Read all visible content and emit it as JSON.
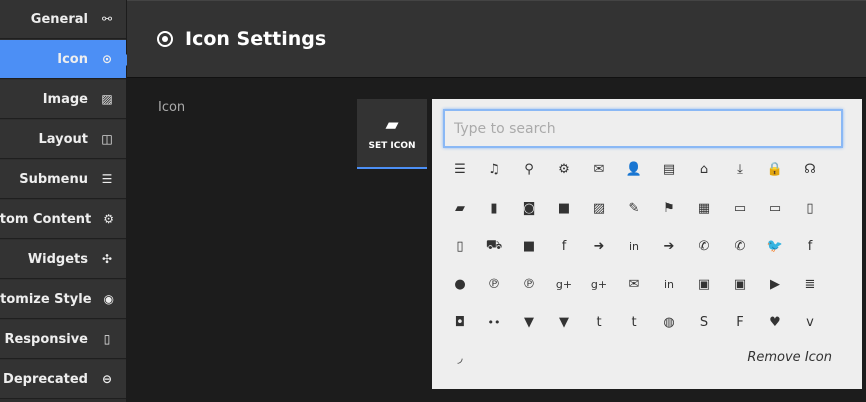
{
  "sidebar": {
    "items": [
      {
        "label": "General",
        "icon": "link-icon",
        "glyph": "⚯"
      },
      {
        "label": "Icon",
        "icon": "dot-circle-icon",
        "glyph": "⊙",
        "active": true
      },
      {
        "label": "Image",
        "icon": "image-icon",
        "glyph": "▨"
      },
      {
        "label": "Layout",
        "icon": "columns-icon",
        "glyph": "◫"
      },
      {
        "label": "Submenu",
        "icon": "list-alt-icon",
        "glyph": "☰"
      },
      {
        "label": "Custom Content",
        "icon": "cogs-icon",
        "glyph": "⚙"
      },
      {
        "label": "Widgets",
        "icon": "puzzle-icon",
        "glyph": "✣"
      },
      {
        "label": "Customize Style",
        "icon": "eye-icon",
        "glyph": "◉"
      },
      {
        "label": "Responsive",
        "icon": "tablet-icon",
        "glyph": "▯"
      },
      {
        "label": "Deprecated",
        "icon": "minus-circle-icon",
        "glyph": "⊖"
      }
    ]
  },
  "header": {
    "title": "Icon Settings"
  },
  "field": {
    "label": "Icon"
  },
  "set_icon": {
    "label": "SET ICON"
  },
  "picker": {
    "search_placeholder": "Type to search",
    "remove_label": "Remove Icon",
    "icons": [
      [
        "bars",
        "☰"
      ],
      [
        "music",
        "♫"
      ],
      [
        "search",
        "⚲"
      ],
      [
        "cog",
        "⚙"
      ],
      [
        "envelope-o",
        "✉"
      ],
      [
        "user",
        "👤"
      ],
      [
        "film",
        "▤"
      ],
      [
        "home",
        "⌂"
      ],
      [
        "download",
        "⤓"
      ],
      [
        "lock",
        "🔒"
      ],
      [
        "headphones",
        "☊"
      ],
      [
        "book",
        "▰"
      ],
      [
        "bookmark",
        "▮"
      ],
      [
        "camera",
        "◙"
      ],
      [
        "video-camera",
        "■"
      ],
      [
        "picture",
        "▨"
      ],
      [
        "pencil",
        "✎"
      ],
      [
        "map-marker",
        "⚑"
      ],
      [
        "calendar",
        "▦"
      ],
      [
        "desktop",
        "▭"
      ],
      [
        "laptop",
        "▭"
      ],
      [
        "tablet",
        "▯"
      ],
      [
        "mobile",
        "▯"
      ],
      [
        "shopping-cart",
        "⛟"
      ],
      [
        "twitter-square",
        "■"
      ],
      [
        "facebook-square",
        "f"
      ],
      [
        "sign-out",
        "➜"
      ],
      [
        "linkedin-square",
        "in"
      ],
      [
        "sign-in",
        "➔"
      ],
      [
        "phone",
        "✆"
      ],
      [
        "phone-square",
        "✆"
      ],
      [
        "twitter",
        "🐦"
      ],
      [
        "facebook",
        "f"
      ],
      [
        "github",
        "●"
      ],
      [
        "pinterest",
        "℗"
      ],
      [
        "pinterest-square",
        "℗"
      ],
      [
        "google-plus-square",
        "g+"
      ],
      [
        "google-plus",
        "g+"
      ],
      [
        "envelope",
        "✉"
      ],
      [
        "linkedin",
        "in"
      ],
      [
        "youtube-square",
        "▣"
      ],
      [
        "youtube",
        "▣"
      ],
      [
        "youtube-play",
        "▶"
      ],
      [
        "stack-overflow",
        "≣"
      ],
      [
        "instagram",
        "◘"
      ],
      [
        "flickr",
        "••"
      ],
      [
        "html5",
        "▼"
      ],
      [
        "css3",
        "▼"
      ],
      [
        "tumblr",
        "t"
      ],
      [
        "tumblr-square",
        "t"
      ],
      [
        "dribbble",
        "◍"
      ],
      [
        "skype",
        "S"
      ],
      [
        "foursquare",
        "F"
      ],
      [
        "heart-circle",
        "♥"
      ],
      [
        "vimeo-square",
        "v"
      ],
      [
        "rss",
        "◞"
      ]
    ]
  }
}
